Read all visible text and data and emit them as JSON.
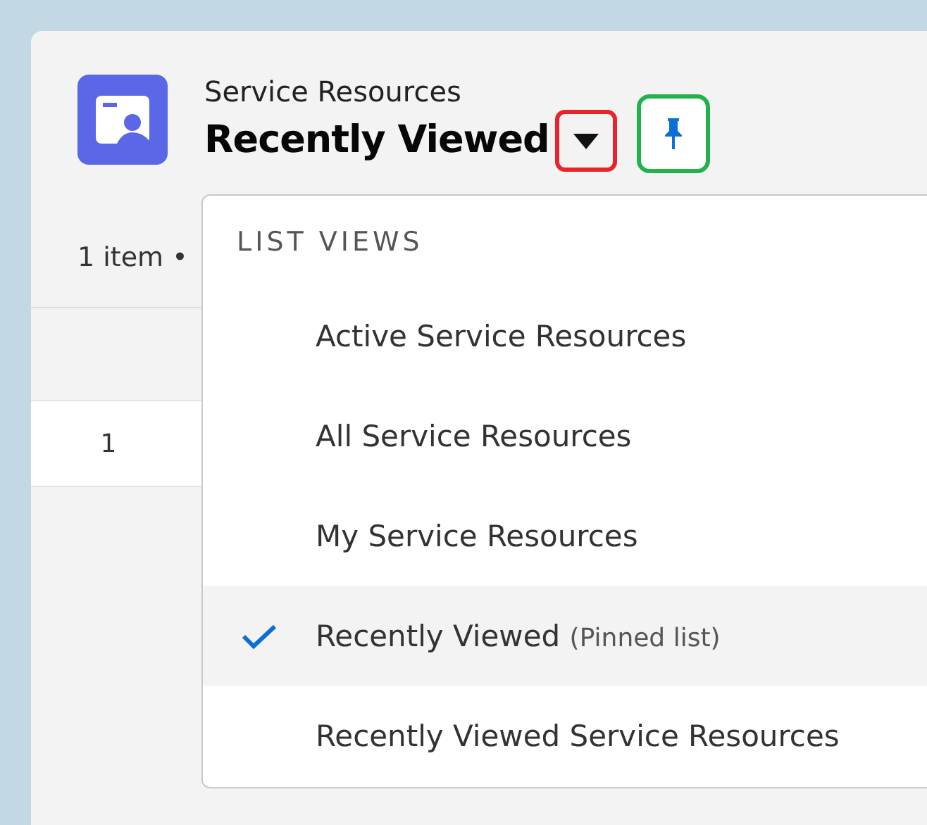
{
  "header": {
    "object_name": "Service Resources",
    "list_title": "Recently Viewed"
  },
  "item_count": "1 item •",
  "table": {
    "rows": [
      {
        "row_number": "1"
      }
    ]
  },
  "list_views_menu": {
    "heading": "LIST VIEWS",
    "items": [
      {
        "label": "Active Service Resources",
        "selected": false
      },
      {
        "label": "All Service Resources",
        "selected": false
      },
      {
        "label": "My Service Resources",
        "selected": false
      },
      {
        "label": "Recently Viewed",
        "note": "(Pinned list)",
        "selected": true
      },
      {
        "label": "Recently Viewed Service Resources",
        "selected": false
      }
    ]
  }
}
